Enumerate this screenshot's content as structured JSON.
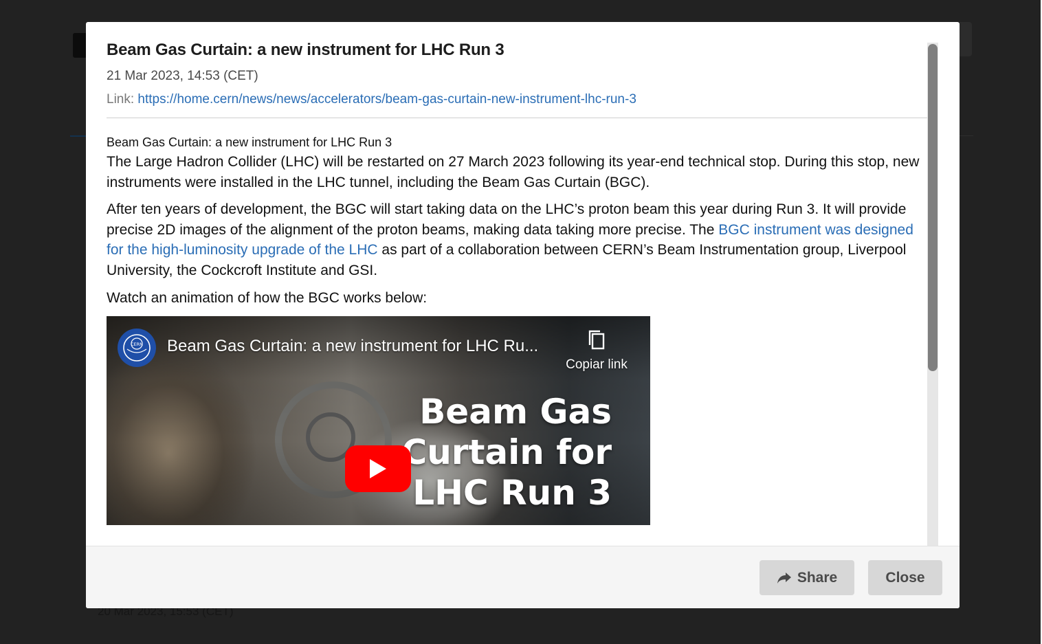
{
  "background": {
    "date_text": "20 Mar 2023, 15:53 (CET)"
  },
  "modal": {
    "title": "Beam Gas Curtain: a new instrument for LHC Run 3",
    "date": "21 Mar 2023, 14:53 (CET)",
    "link_label": "Link: ",
    "link_url": "https://home.cern/news/news/accelerators/beam-gas-curtain-new-instrument-lhc-run-3"
  },
  "article": {
    "subhead": "Beam Gas Curtain: a new instrument for LHC Run 3",
    "para1": "The Large Hadron Collider (LHC) will be restarted on 27 March 2023 following its year-end technical stop. During this stop, new instruments were installed in the LHC tunnel, including the Beam Gas Curtain (BGC).",
    "para2_before": "After ten years of development, the BGC will start taking data on the LHC’s proton beam this year during Run 3. It will provide precise 2D images of the alignment of the proton beams, making data taking more precise. The ",
    "para2_link": "BGC instrument was designed for the high-luminosity upgrade of the LHC",
    "para2_after": " as part of a collaboration between CERN’s Beam Instrumentation group, Liverpool University, the Cockcroft Institute and GSI.",
    "para3": "Watch an animation of how the BGC works below:"
  },
  "video": {
    "title": "Beam Gas Curtain: a new instrument for LHC Ru...",
    "channel_logo_text": "CERN",
    "copy_link_label": "Copiar link",
    "overlay_line1": "Beam Gas",
    "overlay_line2": "Curtain for",
    "overlay_line3": "LHC Run 3",
    "play_color": "#ff0000"
  },
  "scrollbar": {
    "position_fraction": 0.0,
    "visible_fraction": 0.65
  },
  "footer": {
    "share_label": "Share",
    "close_label": "Close"
  },
  "colors": {
    "link": "#2a6db5",
    "overlay_backdrop": "#222222",
    "button_bg": "#d7d7d7"
  }
}
